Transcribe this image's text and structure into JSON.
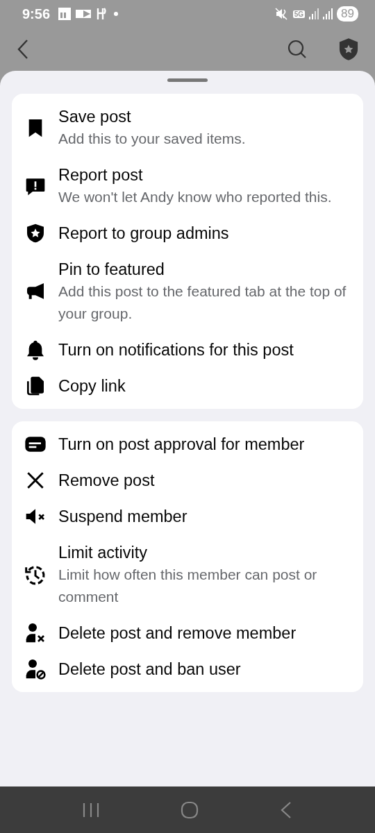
{
  "status_bar": {
    "time": "9:56",
    "network": "5G",
    "battery": "89"
  },
  "sections": [
    {
      "items": [
        {
          "kind": "bookmark",
          "title": "Save post",
          "subtitle": "Add this to your saved items."
        },
        {
          "kind": "report",
          "title": "Report post",
          "subtitle": "We won't let Andy know who reported this."
        },
        {
          "kind": "shield",
          "title": "Report to group admins"
        },
        {
          "kind": "megaphone",
          "title": "Pin to featured",
          "subtitle": "Add this post to the featured tab at the top of your group."
        },
        {
          "kind": "bell",
          "title": "Turn on notifications for this post"
        },
        {
          "kind": "copy",
          "title": "Copy link"
        }
      ]
    },
    {
      "items": [
        {
          "kind": "approval",
          "title": "Turn on post approval for member"
        },
        {
          "kind": "close",
          "title": "Remove post"
        },
        {
          "kind": "mute",
          "title": "Suspend member"
        },
        {
          "kind": "history",
          "title": "Limit activity",
          "subtitle": "Limit how often this member can post or comment"
        },
        {
          "kind": "user-remove",
          "title": "Delete post and remove member"
        },
        {
          "kind": "user-ban",
          "title": "Delete post and ban user"
        }
      ]
    }
  ]
}
